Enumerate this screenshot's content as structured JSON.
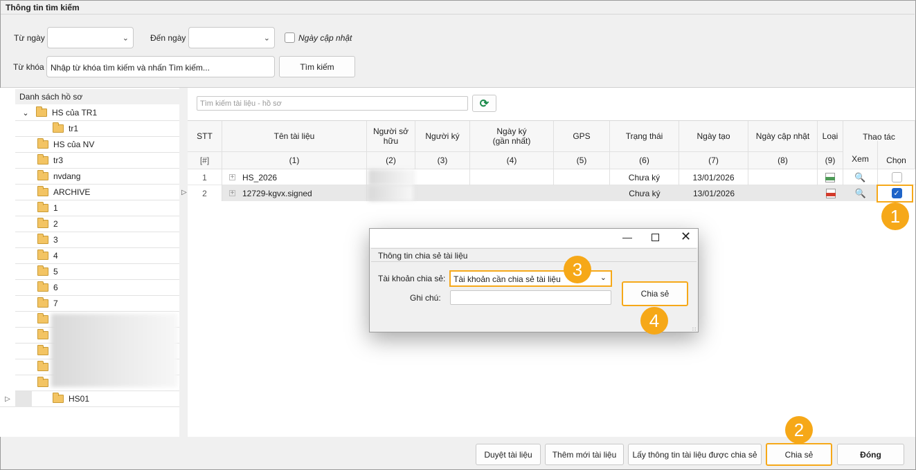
{
  "header": {
    "title": "Thông tin tìm kiếm"
  },
  "search": {
    "from_label": "Từ ngày",
    "to_label": "Đến ngày",
    "updated_label": "Ngày cập nhật",
    "keyword_label": "Từ khóa",
    "keyword_placeholder": "Nhập từ khóa tìm kiếm và nhấn Tìm kiếm...",
    "search_button": "Tìm kiếm"
  },
  "tree": {
    "title": "Danh sách hồ sơ",
    "items": [
      {
        "label": "HS của TR1"
      },
      {
        "label": "tr1"
      },
      {
        "label": "HS của NV"
      },
      {
        "label": "tr3"
      },
      {
        "label": "nvdang"
      },
      {
        "label": "ARCHIVE"
      },
      {
        "label": "1"
      },
      {
        "label": "2"
      },
      {
        "label": "3"
      },
      {
        "label": "4"
      },
      {
        "label": "5"
      },
      {
        "label": "6"
      },
      {
        "label": "7"
      },
      {
        "label": "HS01"
      }
    ]
  },
  "docsearch": {
    "placeholder": "Tìm kiếm tài liệu - hồ sơ"
  },
  "grid": {
    "headers": {
      "stt": "STT",
      "name": "Tên tài liệu",
      "owner": "Người sở hữu",
      "signer": "Người ký",
      "signdate": "Ngày ký (gần nhất)",
      "gps": "GPS",
      "status": "Trạng thái",
      "created": "Ngày tạo",
      "updated": "Ngày cập nhật",
      "type": "Loại",
      "actions": "Thao tác",
      "view": "Xem",
      "select": "Chọn"
    },
    "index": {
      "stt": "[#]",
      "name": "(1)",
      "owner": "(2)",
      "signer": "(3)",
      "signdate": "(4)",
      "gps": "(5)",
      "status": "(6)",
      "created": "(7)",
      "updated": "(8)",
      "type": "(9)"
    },
    "rows": [
      {
        "stt": "1",
        "name": "HS_2026",
        "status": "Chưa ký",
        "created": "13/01/2026",
        "type_icon": "doc-file-icon",
        "selected": false
      },
      {
        "stt": "2",
        "name": "12729-kgvx.signed",
        "status": "Chưa ký",
        "created": "13/01/2026",
        "type_icon": "pdf-file-icon",
        "selected": true
      }
    ]
  },
  "dialog": {
    "group_title": "Thông tin chia sẻ tài liệu",
    "account_label": "Tài khoản chia sẻ:",
    "account_value": "Tài khoản cần chia sẻ tài liệu",
    "note_label": "Ghi chú:",
    "note_value": "",
    "share_button": "Chia sẻ"
  },
  "footer": {
    "browse": "Duyệt tài liệu",
    "add": "Thêm mới tài liệu",
    "fetch_shared": "Lấy thông tin tài liệu được chia sẻ",
    "share": "Chia sẻ",
    "close": "Đóng"
  },
  "steps": [
    "1",
    "2",
    "3",
    "4"
  ],
  "colors": {
    "highlight": "#f6a818",
    "checkbox_checked": "#1f64c8"
  }
}
